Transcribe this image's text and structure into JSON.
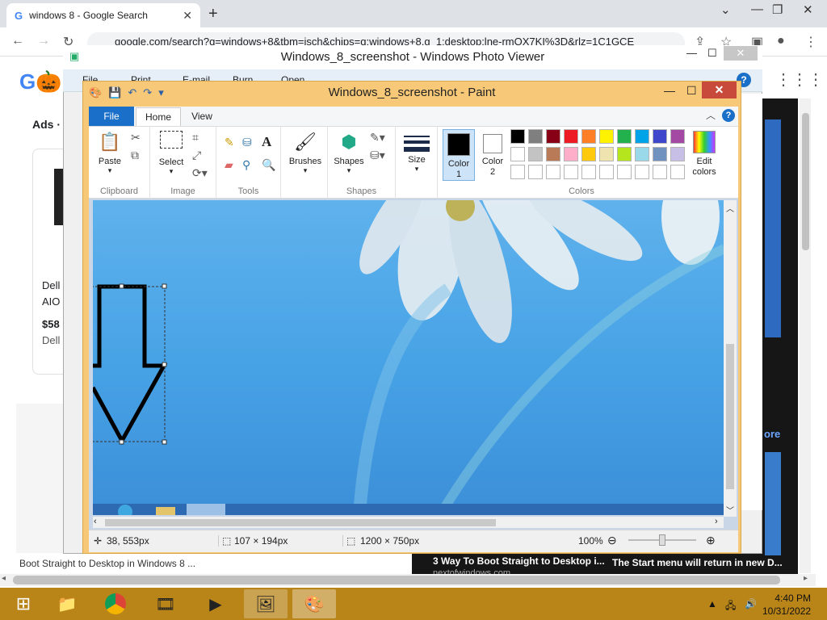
{
  "chrome": {
    "tab_title": "windows 8 - Google Search",
    "tab_favicon": "G",
    "url": "google.com/search?q=windows+8&tbm=isch&chips=q:windows+8,g_1:desktop:lne-rmOX7KI%3D&rlz=1C1GCE"
  },
  "google": {
    "ads_label": "Ads ·",
    "ad_line1": "Dell",
    "ad_line2": "AIO",
    "ad_price": "$58",
    "ad_seller": "Dell",
    "caption_left": "Boot Straight to Desktop in Windows 8 ...",
    "caption_mid": "3 Way To Boot Straight to Desktop i...",
    "caption_mid_source": "nextofwindows.com",
    "caption_right": "The Start menu will return in new D...",
    "more_label": "ore"
  },
  "photo_viewer": {
    "title": "Windows_8_screenshot - Windows Photo Viewer",
    "menu": [
      "File",
      "Print",
      "E-mail",
      "Burn",
      "Open"
    ]
  },
  "paint": {
    "title": "Windows_8_screenshot - Paint",
    "tabs": {
      "file": "File",
      "home": "Home",
      "view": "View"
    },
    "groups": {
      "clipboard": {
        "label": "Clipboard",
        "paste": "Paste"
      },
      "image": {
        "label": "Image",
        "select": "Select"
      },
      "tools": {
        "label": "Tools"
      },
      "brushes": {
        "label": "Brushes"
      },
      "shapes": {
        "label": "Shapes",
        "button": "Shapes"
      },
      "size": {
        "label": "Size"
      },
      "colors": {
        "label": "Colors",
        "color1": "Color",
        "color1_num": "1",
        "color2": "Color",
        "color2_num": "2",
        "edit": "Edit",
        "edit2": "colors"
      }
    },
    "palette_row1": [
      "#000000",
      "#7f7f7f",
      "#880015",
      "#ed1c24",
      "#ff7f27",
      "#fff200",
      "#22b14c",
      "#00a2e8",
      "#3f48cc",
      "#a349a4"
    ],
    "palette_row2": [
      "#ffffff",
      "#c3c3c3",
      "#b97a57",
      "#ffaec9",
      "#ffc90e",
      "#efe4b0",
      "#b5e61d",
      "#99d9ea",
      "#7092be",
      "#c8bfe7"
    ],
    "status": {
      "cursor": "38, 553px",
      "selection": "107 × 194px",
      "image_size": "1200 × 750px",
      "zoom": "100%"
    }
  },
  "taskbar": {
    "time": "4:40 PM",
    "date": "10/31/2022"
  },
  "colors": {
    "taskbar": "#b98418",
    "paint_frame": "#f6c877",
    "file_tab": "#1a6fc9",
    "close_red": "#c74a3a"
  }
}
